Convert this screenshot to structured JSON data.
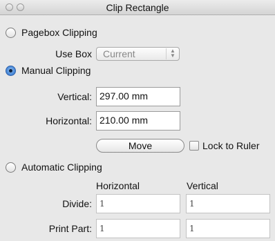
{
  "window": {
    "title": "Clip Rectangle"
  },
  "pagebox": {
    "radio_label": "Pagebox Clipping",
    "selected": false,
    "use_box_label": "Use Box",
    "use_box_value": "Current"
  },
  "manual": {
    "radio_label": "Manual Clipping",
    "selected": true,
    "vertical_label": "Vertical:",
    "vertical_value": "297.00 mm",
    "horizontal_label": "Horizontal:",
    "horizontal_value": "210.00 mm",
    "move_label": "Move",
    "lock_label": "Lock to Ruler",
    "lock_checked": false
  },
  "automatic": {
    "radio_label": "Automatic Clipping",
    "selected": false,
    "col_horizontal": "Horizontal",
    "col_vertical": "Vertical",
    "divide_label": "Divide:",
    "divide_horizontal": "1",
    "divide_vertical": "1",
    "print_part_label": "Print Part:",
    "print_part_horizontal": "1",
    "print_part_vertical": "1"
  }
}
